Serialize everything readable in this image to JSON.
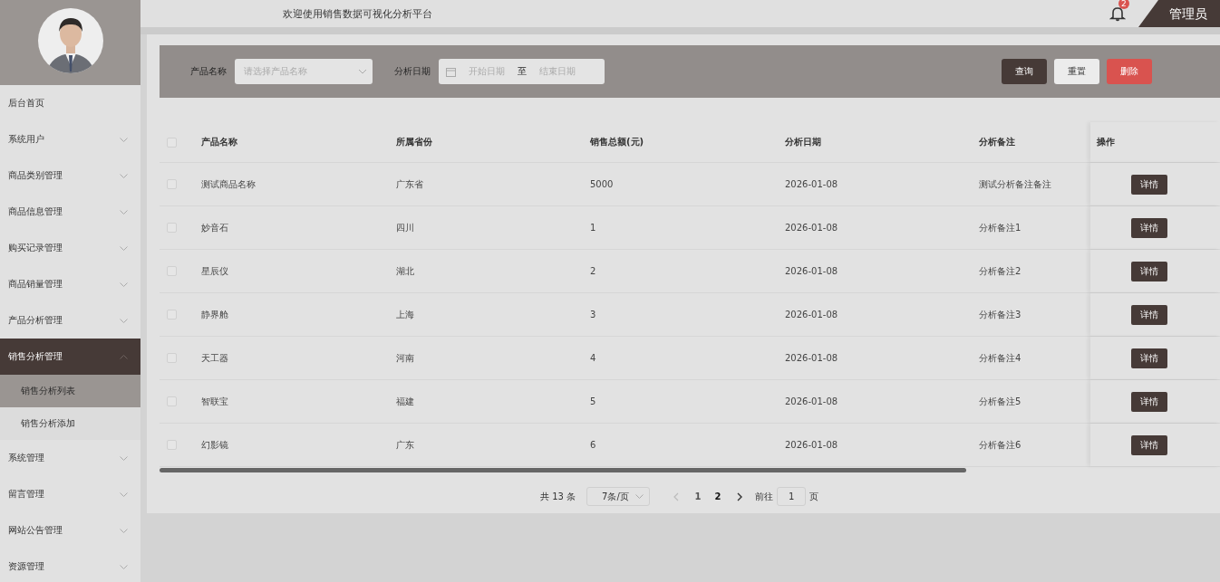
{
  "header": {
    "title": "欢迎使用销售数据可视化分析平台",
    "notification_count": "2",
    "user": "管理员"
  },
  "sidebar": {
    "menu": [
      {
        "label": "后台首页",
        "kind": "link",
        "selected": false
      },
      {
        "label": "系统用户",
        "kind": "submenu",
        "expanded": false,
        "selected": false
      },
      {
        "label": "商品类别管理",
        "kind": "submenu",
        "expanded": false,
        "selected": false
      },
      {
        "label": "商品信息管理",
        "kind": "submenu",
        "expanded": false,
        "selected": false
      },
      {
        "label": "购买记录管理",
        "kind": "submenu",
        "expanded": false,
        "selected": false
      },
      {
        "label": "商品销量管理",
        "kind": "submenu",
        "expanded": false,
        "selected": false
      },
      {
        "label": "产品分析管理",
        "kind": "submenu",
        "expanded": false,
        "selected": false
      },
      {
        "label": "销售分析管理",
        "kind": "submenu",
        "expanded": true,
        "selected": true,
        "children": [
          {
            "label": "销售分析列表",
            "selected": true
          },
          {
            "label": "销售分析添加",
            "selected": false
          }
        ]
      },
      {
        "label": "系统管理",
        "kind": "submenu",
        "expanded": false,
        "selected": false
      },
      {
        "label": "留言管理",
        "kind": "submenu",
        "expanded": false,
        "selected": false
      },
      {
        "label": "网站公告管理",
        "kind": "submenu",
        "expanded": false,
        "selected": false
      },
      {
        "label": "资源管理",
        "kind": "submenu",
        "expanded": false,
        "selected": false
      }
    ]
  },
  "filters": {
    "product_label": "产品名称",
    "product_placeholder": "请选择产品名称",
    "date_label": "分析日期",
    "start_placeholder": "开始日期",
    "range_separator": "至",
    "end_placeholder": "结束日期",
    "buttons": [
      {
        "label": "查询",
        "kind": "primary"
      },
      {
        "label": "重置",
        "kind": "default"
      },
      {
        "label": "删除",
        "kind": "danger"
      }
    ]
  },
  "table": {
    "all_checked": false,
    "columns": [
      "产品名称",
      "所属省份",
      "销售总额(元)",
      "分析日期",
      "分析备注",
      "操作"
    ],
    "rows": [
      {
        "checked": false,
        "cells": [
          "测试商品名称",
          "广东省",
          "5000",
          "2026-01-08",
          "测试分析备注备注"
        ],
        "action": "详情"
      },
      {
        "checked": false,
        "cells": [
          "妙音石",
          "四川",
          "1",
          "2026-01-08",
          "分析备注1"
        ],
        "action": "详情"
      },
      {
        "checked": false,
        "cells": [
          "星辰仪",
          "湖北",
          "2",
          "2026-01-08",
          "分析备注2"
        ],
        "action": "详情"
      },
      {
        "checked": false,
        "cells": [
          "静界舱",
          "上海",
          "3",
          "2026-01-08",
          "分析备注3"
        ],
        "action": "详情"
      },
      {
        "checked": false,
        "cells": [
          "天工器",
          "河南",
          "4",
          "2026-01-08",
          "分析备注4"
        ],
        "action": "详情"
      },
      {
        "checked": false,
        "cells": [
          "智联宝",
          "福建",
          "5",
          "2026-01-08",
          "分析备注5"
        ],
        "action": "详情"
      },
      {
        "checked": false,
        "cells": [
          "幻影镜",
          "广东",
          "6",
          "2026-01-08",
          "分析备注6"
        ],
        "action": "详情"
      }
    ]
  },
  "pagination": {
    "total": "共 13 条",
    "page_size": "7条/页",
    "pages": [
      {
        "label": "1",
        "selected": false
      },
      {
        "label": "2",
        "selected": true
      }
    ],
    "goto_label": "前往",
    "goto_value": "1",
    "goto_suffix": "页"
  }
}
